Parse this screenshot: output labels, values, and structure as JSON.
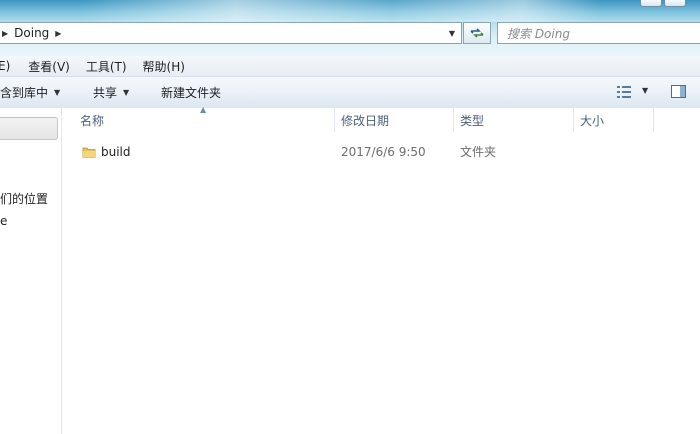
{
  "address": {
    "crumb": "Doing"
  },
  "search": {
    "placeholder": "搜索 Doing"
  },
  "menu": {
    "items": [
      {
        "label": "E)"
      },
      {
        "label": "查看(V)"
      },
      {
        "label": "工具(T)"
      },
      {
        "label": "帮助(H)"
      }
    ]
  },
  "toolbar": {
    "include_library": "含到库中",
    "share": "共享",
    "new_folder": "新建文件夹"
  },
  "nav": {
    "item_recent": "们的位置",
    "item_e": "e"
  },
  "columns": {
    "name": "名称",
    "modified": "修改日期",
    "type": "类型",
    "size": "大小"
  },
  "files": [
    {
      "name": "build",
      "modified": "2017/6/6 9:50",
      "type": "文件夹",
      "size": ""
    }
  ],
  "icons": {
    "folder": "folder-icon",
    "refresh": "refresh-icon",
    "views": "views-icon",
    "preview": "preview-pane-icon"
  },
  "colors": {
    "accent": "#3c95c0",
    "header_text": "#4c607a"
  }
}
